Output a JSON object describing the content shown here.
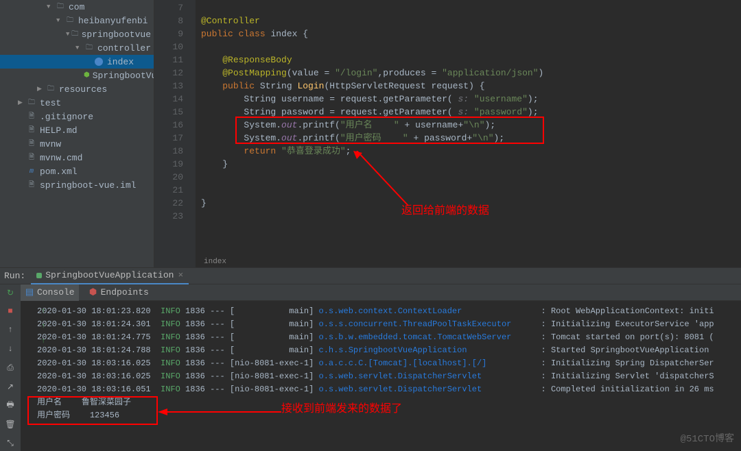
{
  "tree": {
    "com": "com",
    "heibanyufenbi": "heibanyufenbi",
    "springbootvue": "springbootvue",
    "controller": "controller",
    "index": "index",
    "springbootVueAp": "SpringbootVueAp...",
    "resources": "resources",
    "test": "test",
    "gitignore": ".gitignore",
    "helpmd": "HELP.md",
    "mvnw": "mvnw",
    "mvnwcmd": "mvnw.cmd",
    "pomxml": "pom.xml",
    "springbootvueiml": "springboot-vue.iml"
  },
  "code": {
    "l7": "",
    "l8a": "@Controller",
    "l9a": "public",
    "l9b": "class",
    "l9c": "index {",
    "l11a": "@ResponseBody",
    "l12a": "@PostMapping",
    "l12b": "(value = ",
    "l12c": "\"/login\"",
    "l12d": ",produces = ",
    "l12e": "\"application/json\"",
    "l12f": ")",
    "l13a": "public",
    "l13b": "String ",
    "l13c": "Login",
    "l13d": "(HttpServletRequest request) {",
    "l14a": "String username = request.getParameter( ",
    "l14p": "s: ",
    "l14s": "\"username\"",
    "l14e": ");",
    "l15a": "String password = request.getParameter( ",
    "l15p": "s: ",
    "l15s": "\"password\"",
    "l15e": ");",
    "l16a": "System.",
    "l16b": "out",
    "l16c": ".printf(",
    "l16s1": "\"用户名    \"",
    "l16d": " + username+",
    "l16s2": "\"\\n\"",
    "l16e": ");",
    "l17a": "System.",
    "l17b": "out",
    "l17c": ".printf(",
    "l17s1": "\"用户密码    \"",
    "l17d": " + password+",
    "l17s2": "\"\\n\"",
    "l17e": ");",
    "l18a": "return ",
    "l18s": "\"恭喜登录成功\"",
    "l18e": ";",
    "l19": "}",
    "l22": "}",
    "breadcrumb": "index"
  },
  "gutter": [
    "7",
    "8",
    "9",
    "10",
    "11",
    "12",
    "13",
    "14",
    "15",
    "16",
    "17",
    "18",
    "19",
    "20",
    "21",
    "22",
    "23"
  ],
  "annotations": {
    "returnData": "返回给前端的数据",
    "receivedData": "接收到前端发来的数据了"
  },
  "run": {
    "label": "Run:",
    "tab": "SpringbootVueApplication",
    "console": "Console",
    "endpoints": "Endpoints"
  },
  "logs": [
    {
      "ts": "2020-01-30 18:01:23.820",
      "lvl": "INFO",
      "pid": "1836",
      "thread": "[           main]",
      "cls": "o.s.web.context.ContextLoader",
      "msg": ": Root WebApplicationContext: initi"
    },
    {
      "ts": "2020-01-30 18:01:24.301",
      "lvl": "INFO",
      "pid": "1836",
      "thread": "[           main]",
      "cls": "o.s.s.concurrent.ThreadPoolTaskExecutor",
      "msg": ": Initializing ExecutorService 'app"
    },
    {
      "ts": "2020-01-30 18:01:24.775",
      "lvl": "INFO",
      "pid": "1836",
      "thread": "[           main]",
      "cls": "o.s.b.w.embedded.tomcat.TomcatWebServer",
      "msg": ": Tomcat started on port(s): 8081 ("
    },
    {
      "ts": "2020-01-30 18:01:24.788",
      "lvl": "INFO",
      "pid": "1836",
      "thread": "[           main]",
      "cls": "c.h.s.SpringbootVueApplication",
      "msg": ": Started SpringbootVueApplication "
    },
    {
      "ts": "2020-01-30 18:03:16.025",
      "lvl": "INFO",
      "pid": "1836",
      "thread": "[nio-8081-exec-1]",
      "cls": "o.a.c.c.C.[Tomcat].[localhost].[/]",
      "msg": ": Initializing Spring DispatcherSer"
    },
    {
      "ts": "2020-01-30 18:03:16.025",
      "lvl": "INFO",
      "pid": "1836",
      "thread": "[nio-8081-exec-1]",
      "cls": "o.s.web.servlet.DispatcherServlet",
      "msg": ": Initializing Servlet 'dispatcherS"
    },
    {
      "ts": "2020-01-30 18:03:16.051",
      "lvl": "INFO",
      "pid": "1836",
      "thread": "[nio-8081-exec-1]",
      "cls": "o.s.web.servlet.DispatcherServlet",
      "msg": ": Completed initialization in 26 ms"
    }
  ],
  "output": {
    "line1a": "用户名    ",
    "line1b": "鲁智深菜园子",
    "line2a": "用户密码    ",
    "line2b": "123456"
  },
  "watermark": "@51CTO博客"
}
